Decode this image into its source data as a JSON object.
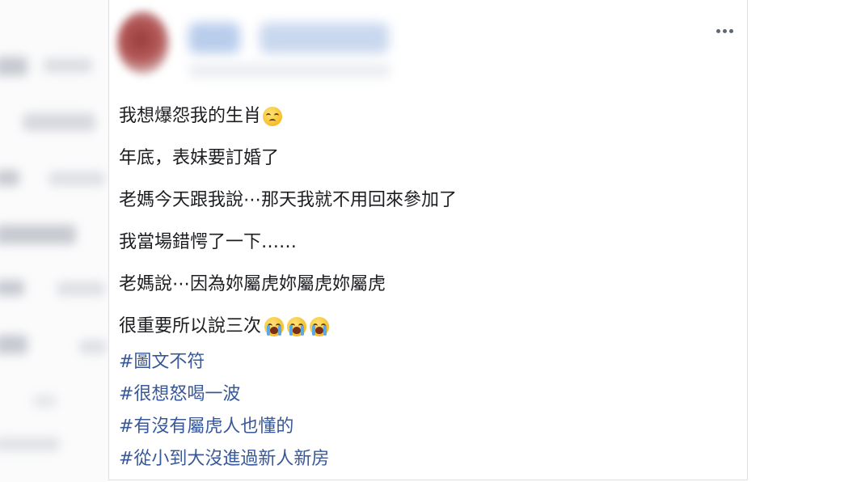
{
  "post": {
    "lines": [
      "我想爆怨我的生肖",
      "年底，表妹要訂婚了",
      "老媽今天跟我說⋯那天我就不用回來參加了",
      "我當場錯愕了一下……",
      "老媽說⋯因為妳屬虎妳屬虎妳屬虎",
      "很重要所以說三次"
    ],
    "emoji": {
      "line1": "pensive-face-emoji",
      "line6": "loudly-crying-face-emoji"
    },
    "hashtags": [
      "#圖文不符",
      "#很想怒喝一波",
      "#有沒有屬虎人也懂的",
      "#從小到大沒進過新人新房"
    ]
  },
  "colors": {
    "text": "#1c1e21",
    "hashtag": "#385898",
    "icon": "#606770",
    "card_border": "#dddfe2"
  }
}
